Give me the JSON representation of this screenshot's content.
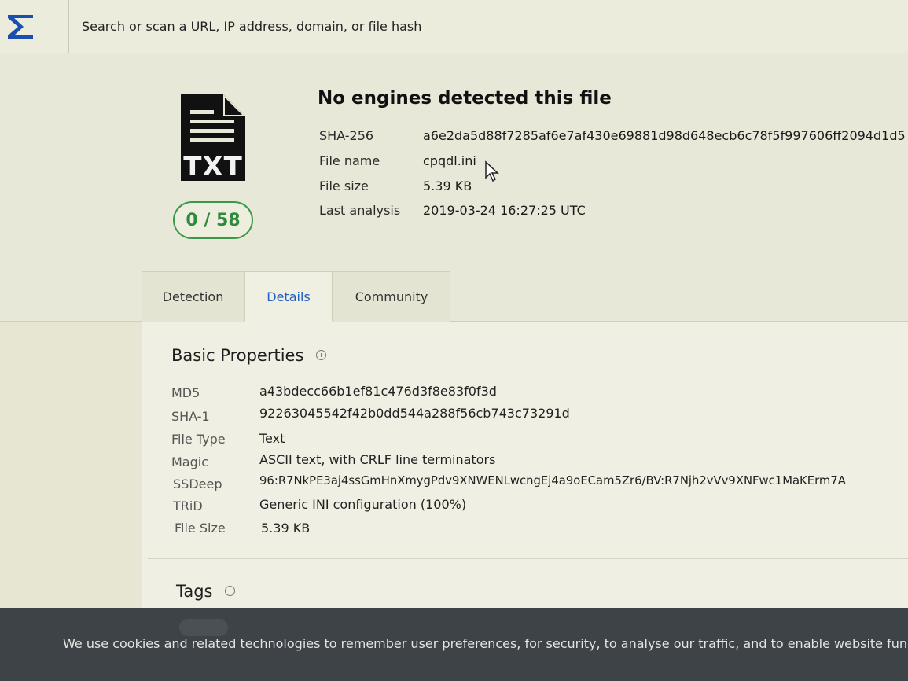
{
  "search": {
    "placeholder": "Search or scan a URL, IP address, domain, or file hash"
  },
  "logo": {
    "icon": "sigma-logo-icon",
    "color": "#1a4fb0"
  },
  "file": {
    "type_label": "TXT",
    "score": "0 / 58",
    "title": "No engines detected this file",
    "meta": [
      {
        "label": "SHA-256",
        "value": "a6e2da5d88f7285af6e7af430e69881d98d648ecb6c78f5f997606ff2094d1d5"
      },
      {
        "label": "File name",
        "value": "cpqdl.ini"
      },
      {
        "label": "File size",
        "value": "5.39 KB"
      },
      {
        "label": "Last analysis",
        "value": "2019-03-24 16:27:25 UTC"
      }
    ]
  },
  "tabs": [
    {
      "label": "Detection",
      "active": false
    },
    {
      "label": "Details",
      "active": true
    },
    {
      "label": "Community",
      "active": false
    }
  ],
  "basic_properties": {
    "title": "Basic Properties",
    "rows": [
      {
        "label": "MD5",
        "value": "a43bdecc66b1ef81c476d3f8e83f0f3d"
      },
      {
        "label": "SHA-1",
        "value": "92263045542f42b0dd544a288f56cb743c73291d"
      },
      {
        "label": "File Type",
        "value": "Text"
      },
      {
        "label": "Magic",
        "value": "ASCII text, with CRLF line terminators"
      },
      {
        "label": "SSDeep",
        "value": "96:R7NkPE3aj4ssGmHnXmygPdv9XNWENLwcngEj4a9oECam5Zr6/BV:R7Njh2vVv9XNFwc1MaKErm7A"
      },
      {
        "label": "TRiD",
        "value": "Generic INI configuration (100%)"
      },
      {
        "label": "File Size",
        "value": "5.39 KB"
      }
    ]
  },
  "tags": {
    "title": "Tags"
  },
  "cookie": {
    "text": "We use cookies and related technologies to remember user preferences, for security, to analyse our traffic, and to enable website functiona"
  },
  "colors": {
    "accent": "#1f5fbf",
    "clean": "#2f8a3e",
    "banner": "#3e4347"
  }
}
